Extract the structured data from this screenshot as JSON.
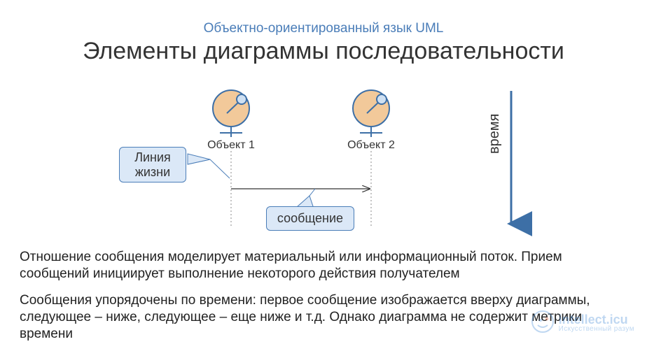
{
  "header": {
    "subtitle": "Объектно-ориентированный язык UML",
    "title": "Элементы диаграммы последовательности"
  },
  "diagram": {
    "object1_label": "Объект 1",
    "object2_label": "Объект 2",
    "lifeline_callout": "Линия жизни",
    "message_callout": "сообщение",
    "time_axis_label": "время"
  },
  "paragraph1": "Отношение сообщения моделирует материальный или информационный поток. Прием сообщений инициирует выполнение некоторого действия получателем",
  "paragraph2": "Сообщения  упорядочены по времени: первое сообщение изображается вверху диаграммы, следующее – ниже, следующее – еще ниже и т.д. Однако диаграмма не содержит метрики времени",
  "watermark": {
    "line1": "intellect.icu",
    "line2": "Искусственный разум"
  },
  "colors": {
    "accent": "#4a7db8",
    "object_fill": "#f2c99a",
    "object_stroke": "#3d6fa6",
    "callout_fill": "#dbe8f7",
    "time_arrow": "#3d6fa6"
  },
  "chart_data": {
    "type": "sequence-diagram",
    "participants": [
      "Объект 1",
      "Объект 2"
    ],
    "lifelines": [
      "Объект 1",
      "Объект 2"
    ],
    "messages": [
      {
        "from": "Объект 1",
        "to": "Объект 2",
        "label": "сообщение"
      }
    ],
    "time_axis": {
      "direction": "down",
      "label": "время"
    },
    "annotations": [
      {
        "target": "lifeline",
        "text": "Линия жизни"
      },
      {
        "target": "message",
        "text": "сообщение"
      }
    ]
  }
}
